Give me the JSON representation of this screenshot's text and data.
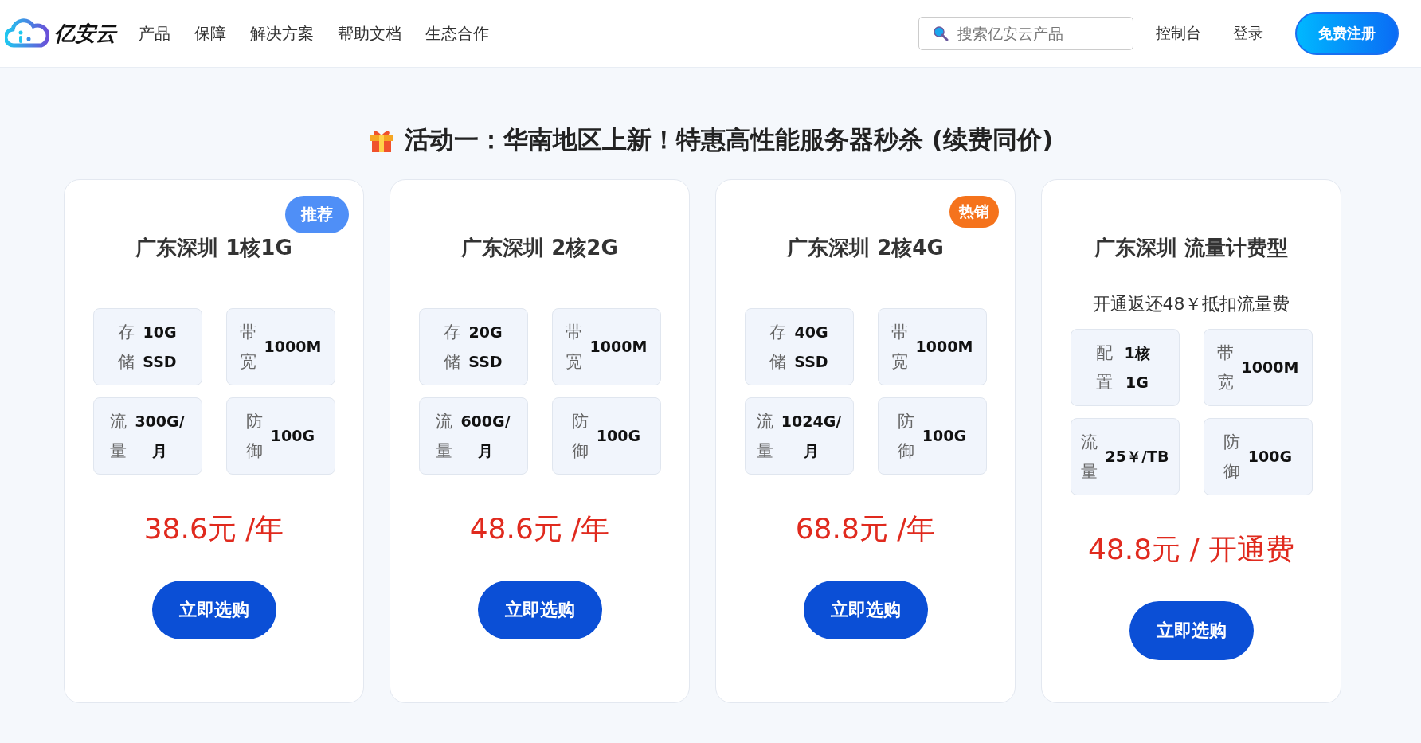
{
  "header": {
    "logo": "亿安云",
    "nav": [
      "产品",
      "保障",
      "解决方案",
      "帮助文档",
      "生态合作"
    ],
    "search": {
      "placeholder": "搜索亿安云产品"
    },
    "links": [
      "控制台",
      "登录"
    ],
    "register": "免费注册"
  },
  "promo": {
    "title": "活动一：华南地区上新！特惠高性能服务器秒杀 (续费同价)",
    "plans": [
      {
        "name": "广东深圳 1核1G",
        "badge": {
          "label": "推荐",
          "color": "#4f8ff7"
        },
        "specs": [
          {
            "label": "存储",
            "value": "10G SSD"
          },
          {
            "label": "带宽",
            "value": "1000M"
          },
          {
            "label": "流量",
            "value": "300G/月"
          },
          {
            "label": "防御",
            "value": "100G"
          }
        ],
        "price": "38.6元 /年",
        "button": "立即选购"
      },
      {
        "name": "广东深圳 2核2G",
        "specs": [
          {
            "label": "存储",
            "value": "20G SSD"
          },
          {
            "label": "带宽",
            "value": "1000M"
          },
          {
            "label": "流量",
            "value": "600G/月"
          },
          {
            "label": "防御",
            "value": "100G"
          }
        ],
        "price": "48.6元 /年",
        "button": "立即选购"
      },
      {
        "name": "广东深圳 2核4G",
        "badge": {
          "label": "热销",
          "color": "#f5731c"
        },
        "specs": [
          {
            "label": "存储",
            "value": "40G SSD"
          },
          {
            "label": "带宽",
            "value": "1000M"
          },
          {
            "label": "流量",
            "value": "1024G/月"
          },
          {
            "label": "防御",
            "value": "100G"
          }
        ],
        "price": "68.8元 /年",
        "button": "立即选购"
      },
      {
        "name": "广东深圳 流量计费型",
        "subtitle": "开通返还48￥抵扣流量费",
        "specs": [
          {
            "label": "配置",
            "value": "1核 1G"
          },
          {
            "label": "带宽",
            "value": "1000M"
          },
          {
            "label": "流量",
            "value": "25￥/TB"
          },
          {
            "label": "防御",
            "value": "100G"
          }
        ],
        "price": "48.8元 / 开通费",
        "button": "立即选购"
      }
    ]
  }
}
